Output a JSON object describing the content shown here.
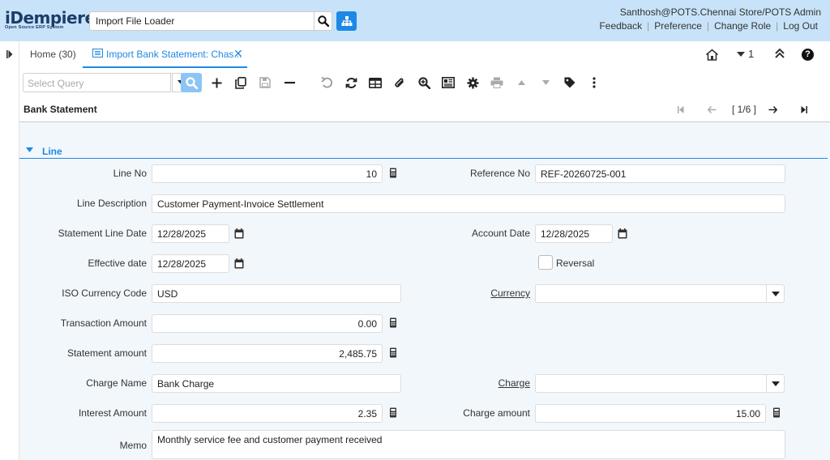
{
  "header": {
    "logo_text": "iDempiere",
    "logo_subtitle": "Open Source ERP System",
    "search_value": "Import File Loader",
    "user": "Santhosh@POTS.Chennai Store/POTS Admin",
    "links": [
      "Feedback",
      "Preference",
      "Change Role",
      "Log Out"
    ]
  },
  "tabs": {
    "home": "Home (30)",
    "active": "Import Bank Statement: Chas...",
    "window_count": "1"
  },
  "toolbar": {
    "query_placeholder": "Select Query"
  },
  "record": {
    "title": "Bank Statement",
    "position": "[ 1/6 ]"
  },
  "section": {
    "title": "Line"
  },
  "form": {
    "line_no": {
      "label": "Line No",
      "value": "10"
    },
    "reference_no": {
      "label": "Reference No",
      "value": "REF-20260725-001"
    },
    "line_description": {
      "label": "Line Description",
      "value": "Customer Payment-Invoice Settlement"
    },
    "statement_line_date": {
      "label": "Statement Line Date",
      "value": "12/28/2025"
    },
    "account_date": {
      "label": "Account Date",
      "value": "12/28/2025"
    },
    "effective_date": {
      "label": "Effective date",
      "value": "12/28/2025"
    },
    "reversal": {
      "label": "Reversal",
      "checked": false
    },
    "iso_currency_code": {
      "label": "ISO Currency Code",
      "value": "USD"
    },
    "currency": {
      "label": "Currency",
      "value": ""
    },
    "transaction_amount": {
      "label": "Transaction Amount",
      "value": "0.00"
    },
    "statement_amount": {
      "label": "Statement amount",
      "value": "2,485.75"
    },
    "charge_name": {
      "label": "Charge Name",
      "value": "Bank Charge"
    },
    "charge": {
      "label": "Charge",
      "value": ""
    },
    "interest_amount": {
      "label": "Interest Amount",
      "value": "2.35"
    },
    "charge_amount": {
      "label": "Charge amount",
      "value": "15.00"
    },
    "memo": {
      "label": "Memo",
      "value": "Monthly service fee and customer payment received"
    }
  },
  "colors": {
    "header_bg": "#c8e3f9",
    "accent": "#1e88e5",
    "content_bg": "#f2f7fc"
  }
}
